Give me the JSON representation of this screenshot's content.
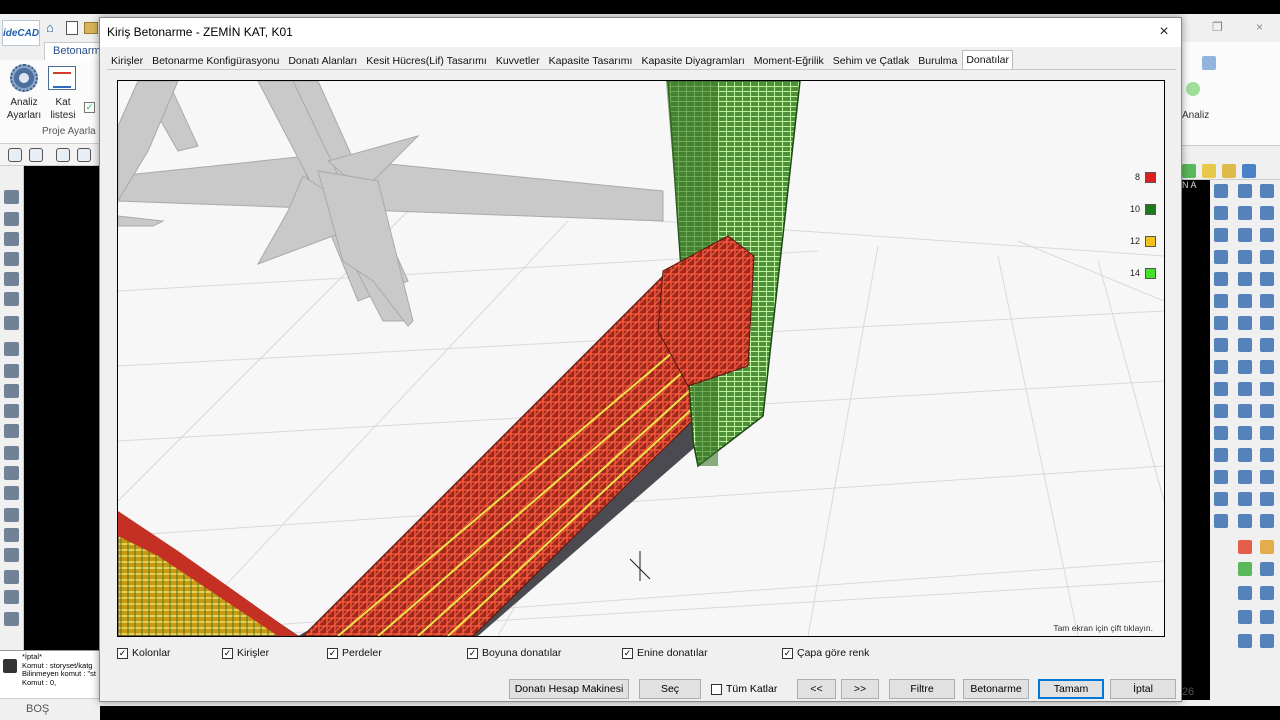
{
  "app": {
    "logo": "ideCAD",
    "ribbon_tab": "Betonarme",
    "analiz_label": "Analiz Ayarları",
    "kat_label": "Kat listesi",
    "group_label": "Proje Ayarla",
    "right_analiz_label": "Analiz",
    "right_black_label": "N A",
    "right_number": "26",
    "status_text": "BOŞ",
    "command_lines": [
      "*İptal*",
      "Komut : storyset/katg",
      "Bilinmeyen komut : \"st",
      "Komut : 0,"
    ]
  },
  "dialog": {
    "title": "Kiriş Betonarme - ZEMİN KAT, K01",
    "close": "×",
    "tabs": [
      {
        "label": "Kirişler",
        "active": false
      },
      {
        "label": "Betonarme Konfigürasyonu",
        "active": false
      },
      {
        "label": "Donatı Alanları",
        "active": false
      },
      {
        "label": "Kesit Hücres(Lif) Tasarımı",
        "active": false
      },
      {
        "label": "Kuvvetler",
        "active": false
      },
      {
        "label": "Kapasite Tasarımı",
        "active": false
      },
      {
        "label": "Kapasite Diyagramları",
        "active": false
      },
      {
        "label": "Moment-Eğrilik",
        "active": false
      },
      {
        "label": "Sehim ve Çatlak",
        "active": false
      },
      {
        "label": "Burulma",
        "active": false
      },
      {
        "label": "Donatılar",
        "active": true
      }
    ],
    "legend": [
      {
        "label": "8",
        "color": "#e02020"
      },
      {
        "label": "10",
        "color": "#1e7a1e"
      },
      {
        "label": "12",
        "color": "#f2c21a"
      },
      {
        "label": "14",
        "color": "#44e02a"
      }
    ],
    "hint": "Tam ekran için çift tıklayın.",
    "checkboxes": [
      {
        "label": "Kolonlar",
        "checked": true
      },
      {
        "label": "Kirişler",
        "checked": true
      },
      {
        "label": "Perdeler",
        "checked": true
      },
      {
        "label": "Boyuna donatılar",
        "checked": true
      },
      {
        "label": "Enine donatılar",
        "checked": true
      },
      {
        "label": "Çapa göre renk",
        "checked": true
      }
    ],
    "buttons": {
      "calc": "Donatı Hesap Makinesi",
      "sec": "Seç",
      "tum_katlar": "Tüm Katlar",
      "prev": "<<",
      "next": ">>",
      "filtre": "Filtre",
      "betonarme": "Betonarme",
      "tamam": "Tamam",
      "iptal": "İptal"
    },
    "tum_katlar_checked": false
  }
}
